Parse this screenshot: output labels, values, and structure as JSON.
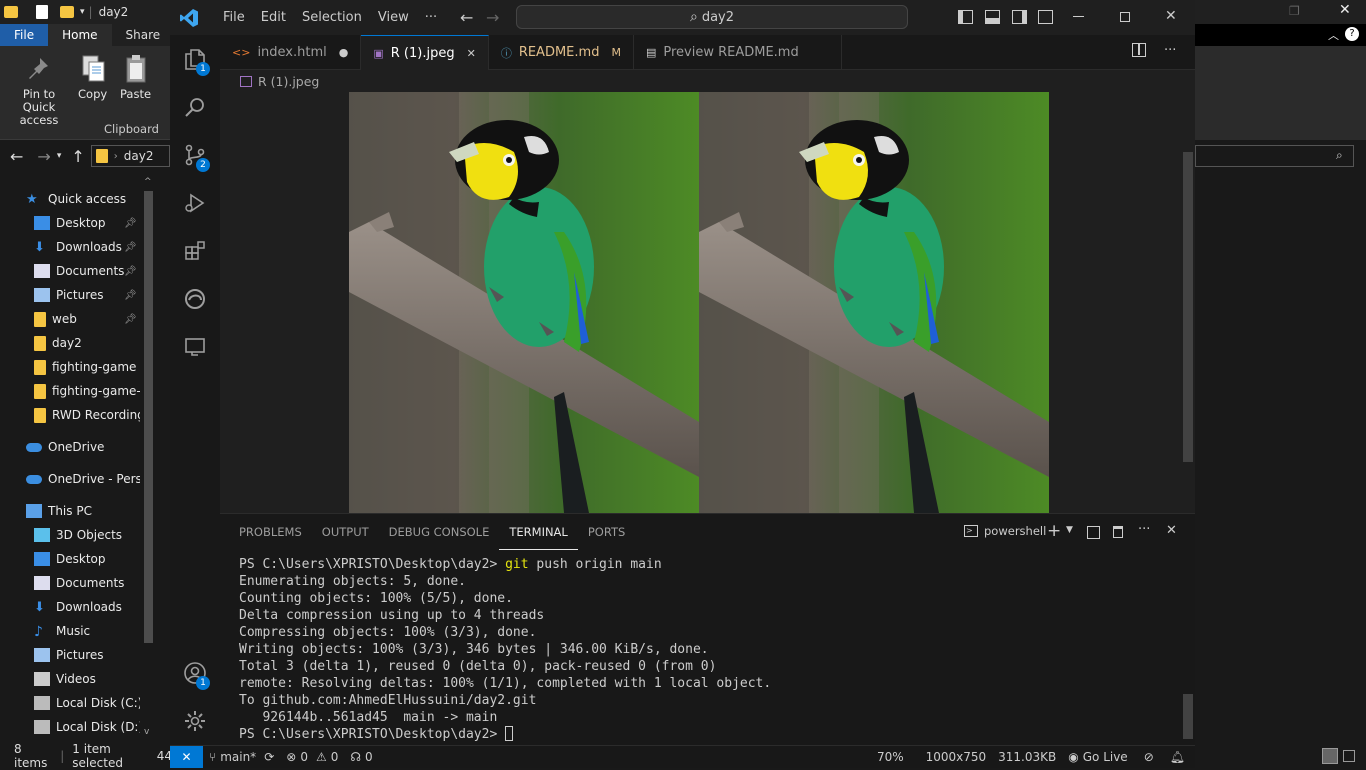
{
  "explorer": {
    "title": "day2",
    "tabs": [
      "File",
      "Home",
      "Share"
    ],
    "ribbon": {
      "pin_label": "Pin to Quick access",
      "copy_label": "Copy",
      "paste_label": "Paste",
      "group_label": "Clipboard"
    },
    "address": "day2",
    "nav": [
      {
        "label": "Quick access",
        "icon": "star-icon",
        "pinned": false
      },
      {
        "label": "Desktop",
        "icon": "desktop-icon",
        "pinned": true
      },
      {
        "label": "Downloads",
        "icon": "download-icon",
        "pinned": true
      },
      {
        "label": "Documents",
        "icon": "document-icon",
        "pinned": true
      },
      {
        "label": "Pictures",
        "icon": "pictures-icon",
        "pinned": true
      },
      {
        "label": "web",
        "icon": "folder-icon",
        "pinned": true
      },
      {
        "label": "day2",
        "icon": "folder-icon",
        "pinned": false
      },
      {
        "label": "fighting-game",
        "icon": "folder-icon",
        "pinned": false
      },
      {
        "label": "fighting-game-r",
        "icon": "folder-icon",
        "pinned": false
      },
      {
        "label": "RWD Recording",
        "icon": "folder-icon",
        "pinned": false
      },
      {
        "label": "OneDrive",
        "icon": "cloud-icon",
        "pinned": false
      },
      {
        "label": "OneDrive - Persor",
        "icon": "cloud-icon",
        "pinned": false
      },
      {
        "label": "This PC",
        "icon": "pc-icon",
        "pinned": false
      },
      {
        "label": "3D Objects",
        "icon": "cube-icon",
        "pinned": false
      },
      {
        "label": "Desktop",
        "icon": "desktop-icon",
        "pinned": false
      },
      {
        "label": "Documents",
        "icon": "document-icon",
        "pinned": false
      },
      {
        "label": "Downloads",
        "icon": "download-icon",
        "pinned": false
      },
      {
        "label": "Music",
        "icon": "music-icon",
        "pinned": false
      },
      {
        "label": "Pictures",
        "icon": "pictures-icon",
        "pinned": false
      },
      {
        "label": "Videos",
        "icon": "video-icon",
        "pinned": false
      },
      {
        "label": "Local Disk (C:)",
        "icon": "disk-icon",
        "pinned": false
      },
      {
        "label": "Local Disk (D:)",
        "icon": "disk-icon",
        "pinned": false
      }
    ],
    "status": {
      "items": "8 items",
      "selected": "1 item selected",
      "size_fragment": "44"
    }
  },
  "vscode": {
    "menu": [
      "File",
      "Edit",
      "Selection",
      "View",
      "···"
    ],
    "search": "day2",
    "badges": {
      "explorer": "1",
      "source_control": "2",
      "accounts": "1"
    },
    "tabs": [
      {
        "label": "index.html",
        "icon": "html-icon",
        "marker": "●",
        "active": false
      },
      {
        "label": "R (1).jpeg",
        "icon": "image-icon",
        "marker": "✕",
        "active": true
      },
      {
        "label": "README.md",
        "icon": "info-icon",
        "marker": "M",
        "active": false
      },
      {
        "label": "Preview README.md",
        "icon": "preview-icon",
        "marker": "",
        "active": false
      }
    ],
    "breadcrumb": "R (1).jpeg",
    "panel": {
      "tabs": [
        "PROBLEMS",
        "OUTPUT",
        "DEBUG CONSOLE",
        "TERMINAL",
        "PORTS"
      ],
      "active_tab": "TERMINAL",
      "shell": "powershell"
    },
    "terminal": {
      "prompt": "PS C:\\Users\\XPRISTO\\Desktop\\day2> ",
      "command_git": "git",
      "command_rest": " push origin main",
      "lines": [
        "Enumerating objects: 5, done.",
        "Counting objects: 100% (5/5), done.",
        "Delta compression using up to 4 threads",
        "Compressing objects: 100% (3/3), done.",
        "Writing objects: 100% (3/3), 346 bytes | 346.00 KiB/s, done.",
        "Total 3 (delta 1), reused 0 (delta 0), pack-reused 0 (from 0)",
        "remote: Resolving deltas: 100% (1/1), completed with 1 local object.",
        "To github.com:AhmedElHussuini/day2.git",
        "   926144b..561ad45  main -> main"
      ],
      "final_prompt": "PS C:\\Users\\XPRISTO\\Desktop\\day2> "
    },
    "status": {
      "branch": "main*",
      "errors": "0",
      "warnings": "0",
      "ports": "0",
      "zoom": "70%",
      "dimensions": "1000x750",
      "filesize": "311.03KB",
      "golive": "Go Live"
    },
    "colors": {
      "accent": "#0078d4",
      "git_keyword": "#e5e510"
    }
  }
}
